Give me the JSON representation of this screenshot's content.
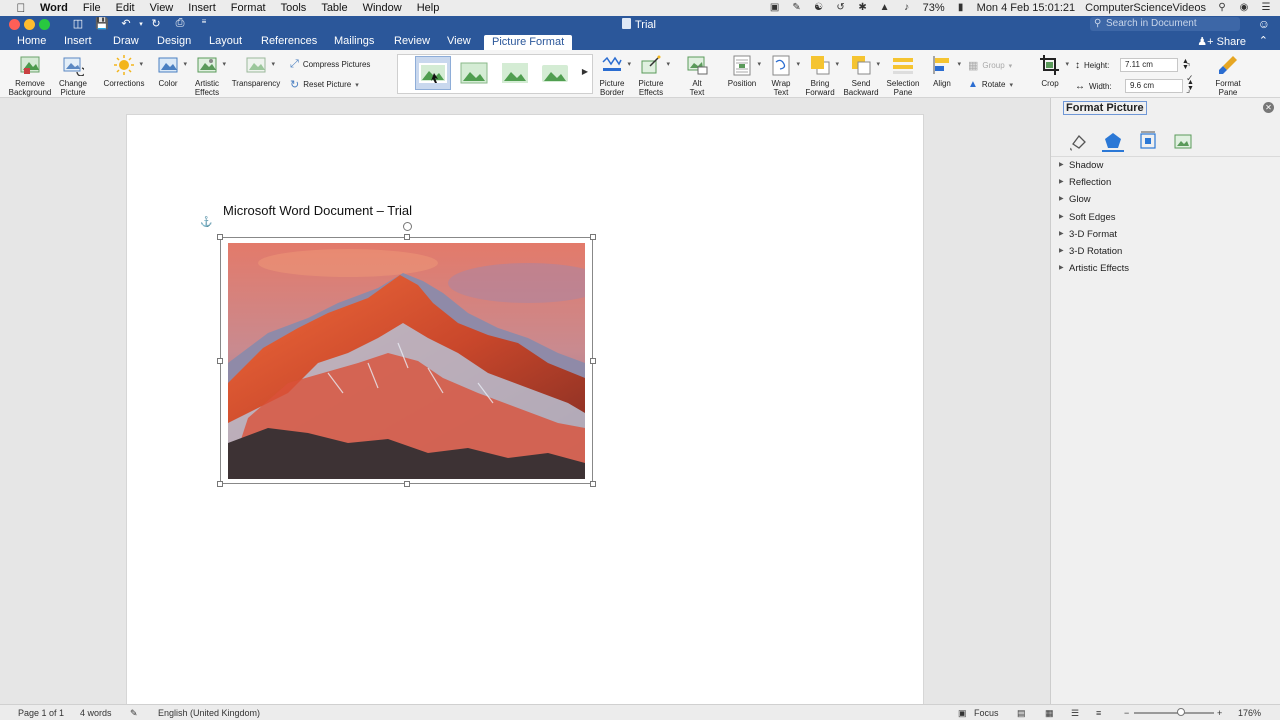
{
  "menubar": {
    "app_name": "Word",
    "items": [
      "File",
      "Edit",
      "View",
      "Insert",
      "Format",
      "Tools",
      "Table",
      "Window",
      "Help"
    ],
    "battery": "73%",
    "clock": "Mon 4 Feb  15:01:21",
    "user": "ComputerScienceVideos"
  },
  "titlebar": {
    "document_title": "Trial",
    "search_placeholder": "Search in Document"
  },
  "tabs": {
    "items": [
      "Home",
      "Insert",
      "Draw",
      "Design",
      "Layout",
      "References",
      "Mailings",
      "Review",
      "View"
    ],
    "active": "Picture Format",
    "share_label": "Share"
  },
  "ribbon": {
    "remove_background": "Remove Background",
    "change_picture": "Change Picture",
    "corrections": "Corrections",
    "color": "Color",
    "artistic_effects": "Artistic Effects",
    "transparency": "Transparency",
    "compress_pictures": "Compress Pictures",
    "reset_picture": "Reset Picture",
    "picture_border": "Picture Border",
    "picture_effects": "Picture Effects",
    "alt_text": "Alt Text",
    "position": "Position",
    "wrap_text": "Wrap Text",
    "bring_forward": "Bring Forward",
    "send_backward": "Send Backward",
    "selection_pane": "Selection Pane",
    "align": "Align",
    "group": "Group",
    "rotate": "Rotate",
    "crop": "Crop",
    "height_label": "Height:",
    "height_value": "7.11 cm",
    "width_label": "Width:",
    "width_value": "9.6 cm",
    "format_pane": "Format Pane"
  },
  "document": {
    "heading": "Microsoft Word Document – Trial"
  },
  "format_pane": {
    "title": "Format Picture",
    "sections": [
      "Shadow",
      "Reflection",
      "Glow",
      "Soft Edges",
      "3-D Format",
      "3-D Rotation",
      "Artistic Effects"
    ]
  },
  "statusbar": {
    "page": "Page 1 of 1",
    "words": "4 words",
    "language": "English (United Kingdom)",
    "focus": "Focus",
    "zoom": "176%"
  },
  "colors": {
    "word_blue": "#2b579a",
    "accent": "#2b78d6"
  }
}
